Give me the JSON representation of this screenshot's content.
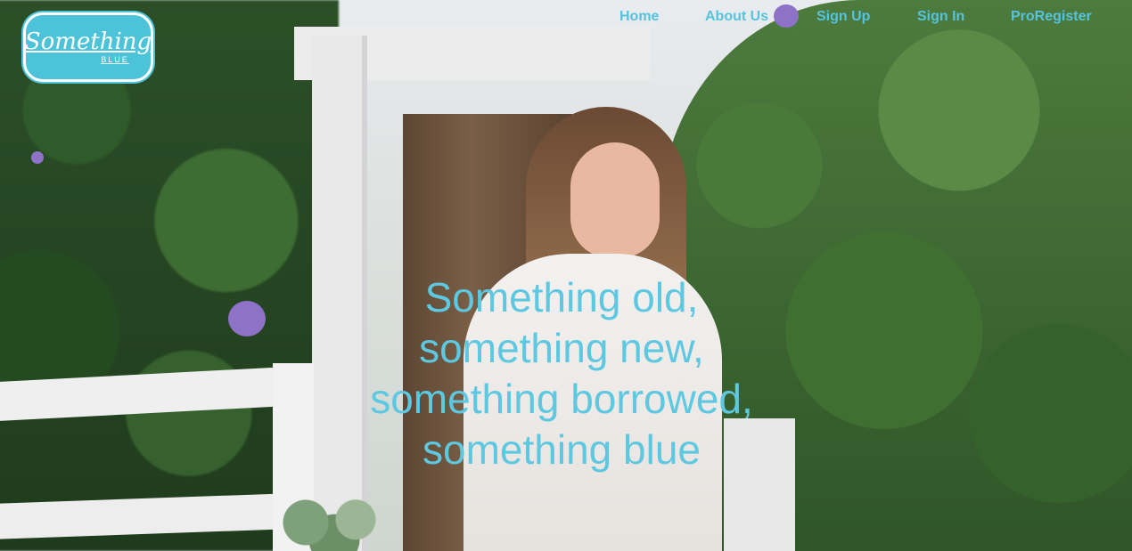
{
  "logo": {
    "main": "Something",
    "sub": "BLUE"
  },
  "nav": {
    "home": "Home",
    "about": "About Us",
    "signup": "Sign Up",
    "signin": "Sign In",
    "pro": "ProRegister"
  },
  "tagline": {
    "line1": "Something old,",
    "line2": "something new,",
    "line3": "something borrowed,",
    "line4": "something blue"
  },
  "colors": {
    "accent": "#54c3df",
    "logo_bg": "#4dc3d9"
  }
}
